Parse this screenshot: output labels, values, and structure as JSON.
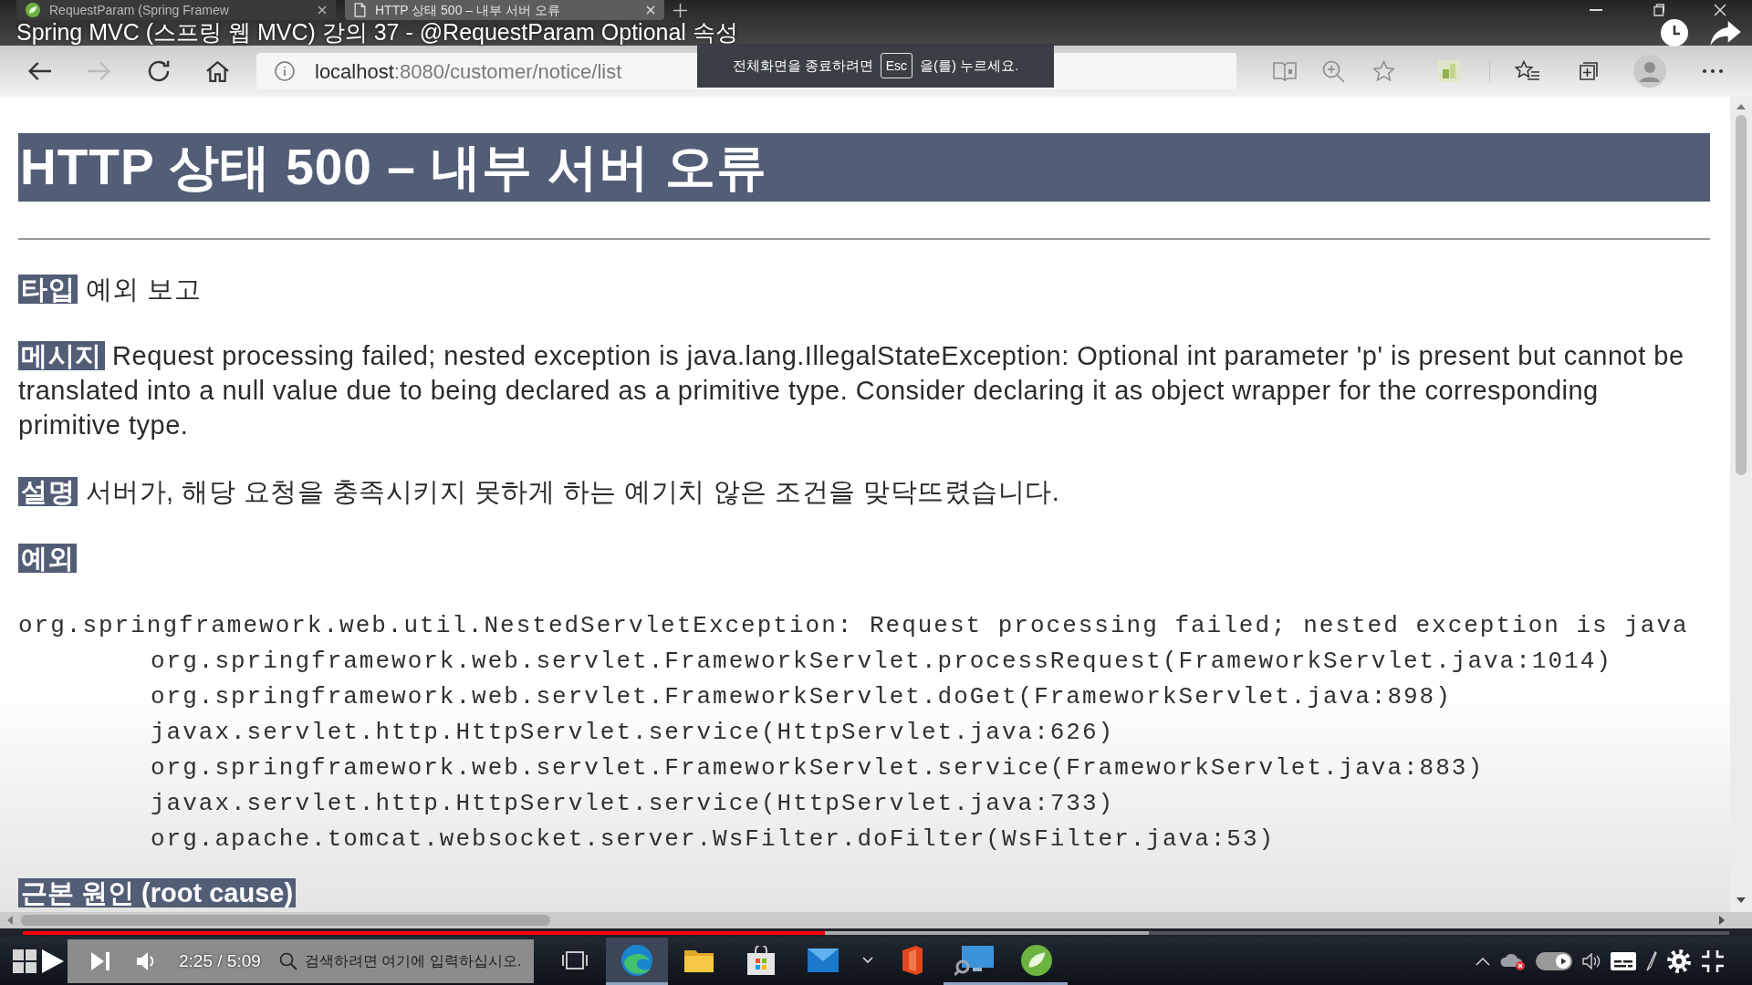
{
  "video": {
    "title": "Spring MVC (스프링 웹 MVC) 강의 37 - @RequestParam Optional 속성",
    "time": "2:25 / 5:09",
    "progress": {
      "level": 0.47,
      "buffered": {
        "level": 0.66
      }
    },
    "autoplay": {
      "on": true
    }
  },
  "browser": {
    "tabs": [
      {
        "kind": "spring",
        "title": "RequestParam (Spring Framew",
        "selected": false
      },
      {
        "kind": "document",
        "title": "HTTP 상태 500 – 내부 서버 오류",
        "selected": true
      }
    ],
    "toolbar": {
      "back": {
        "disabled": false
      },
      "forward": {
        "disabled": true
      }
    },
    "address": {
      "host": "localhost",
      "path": ":8080/customer/notice/list"
    }
  },
  "fullscreen_notice": {
    "before": "전체화면을 종료하려면",
    "key": "Esc",
    "after": "을(를) 누르세요."
  },
  "page": {
    "heading": "HTTP 상태 500 – 내부 서버 오류",
    "fields": [
      {
        "label": "타입",
        "text": "예외 보고"
      },
      {
        "label": "메시지",
        "text": "Request processing failed; nested exception is java.lang.IllegalStateException: Optional int parameter 'p' is present but cannot be translated into a null value due to being declared as a primitive type. Consider declaring it as object wrapper for the corresponding primitive type."
      },
      {
        "label": "설명",
        "text": "서버가, 해당 요청을 충족시키지 못하게 하는 예기치 않은 조건을 맞닥뜨렸습니다."
      }
    ],
    "exception": {
      "label": "예외",
      "message": "org.springframework.web.util.NestedServletException: Request processing failed; nested exception is java",
      "frames": [
        "org.springframework.web.servlet.FrameworkServlet.processRequest(FrameworkServlet.java:1014)",
        "org.springframework.web.servlet.FrameworkServlet.doGet(FrameworkServlet.java:898)",
        "javax.servlet.http.HttpServlet.service(HttpServlet.java:626)",
        "org.springframework.web.servlet.FrameworkServlet.service(FrameworkServlet.java:883)",
        "javax.servlet.http.HttpServlet.service(HttpServlet.java:733)",
        "org.apache.tomcat.websocket.server.WsFilter.doFilter(WsFilter.java:53)"
      ]
    },
    "root_cause": {
      "label": "근본 원인 (root cause)"
    }
  },
  "taskbar": {
    "search": {
      "placeholder": "검색하려면 여기에 입력하십시오."
    },
    "apps": [
      {
        "kind": "task-view",
        "selected": false,
        "running": false
      },
      {
        "kind": "edge",
        "selected": true,
        "running": true
      },
      {
        "kind": "explorer",
        "selected": false,
        "running": false
      },
      {
        "kind": "store",
        "selected": false,
        "running": false
      },
      {
        "kind": "mail",
        "selected": false,
        "running": false
      },
      {
        "kind": "chevron",
        "selected": false,
        "running": false
      },
      {
        "kind": "office",
        "selected": false,
        "running": false
      },
      {
        "kind": "remote-desktop",
        "selected": false,
        "running": true
      },
      {
        "kind": "spring-tool",
        "selected": false,
        "running": true
      }
    ]
  }
}
